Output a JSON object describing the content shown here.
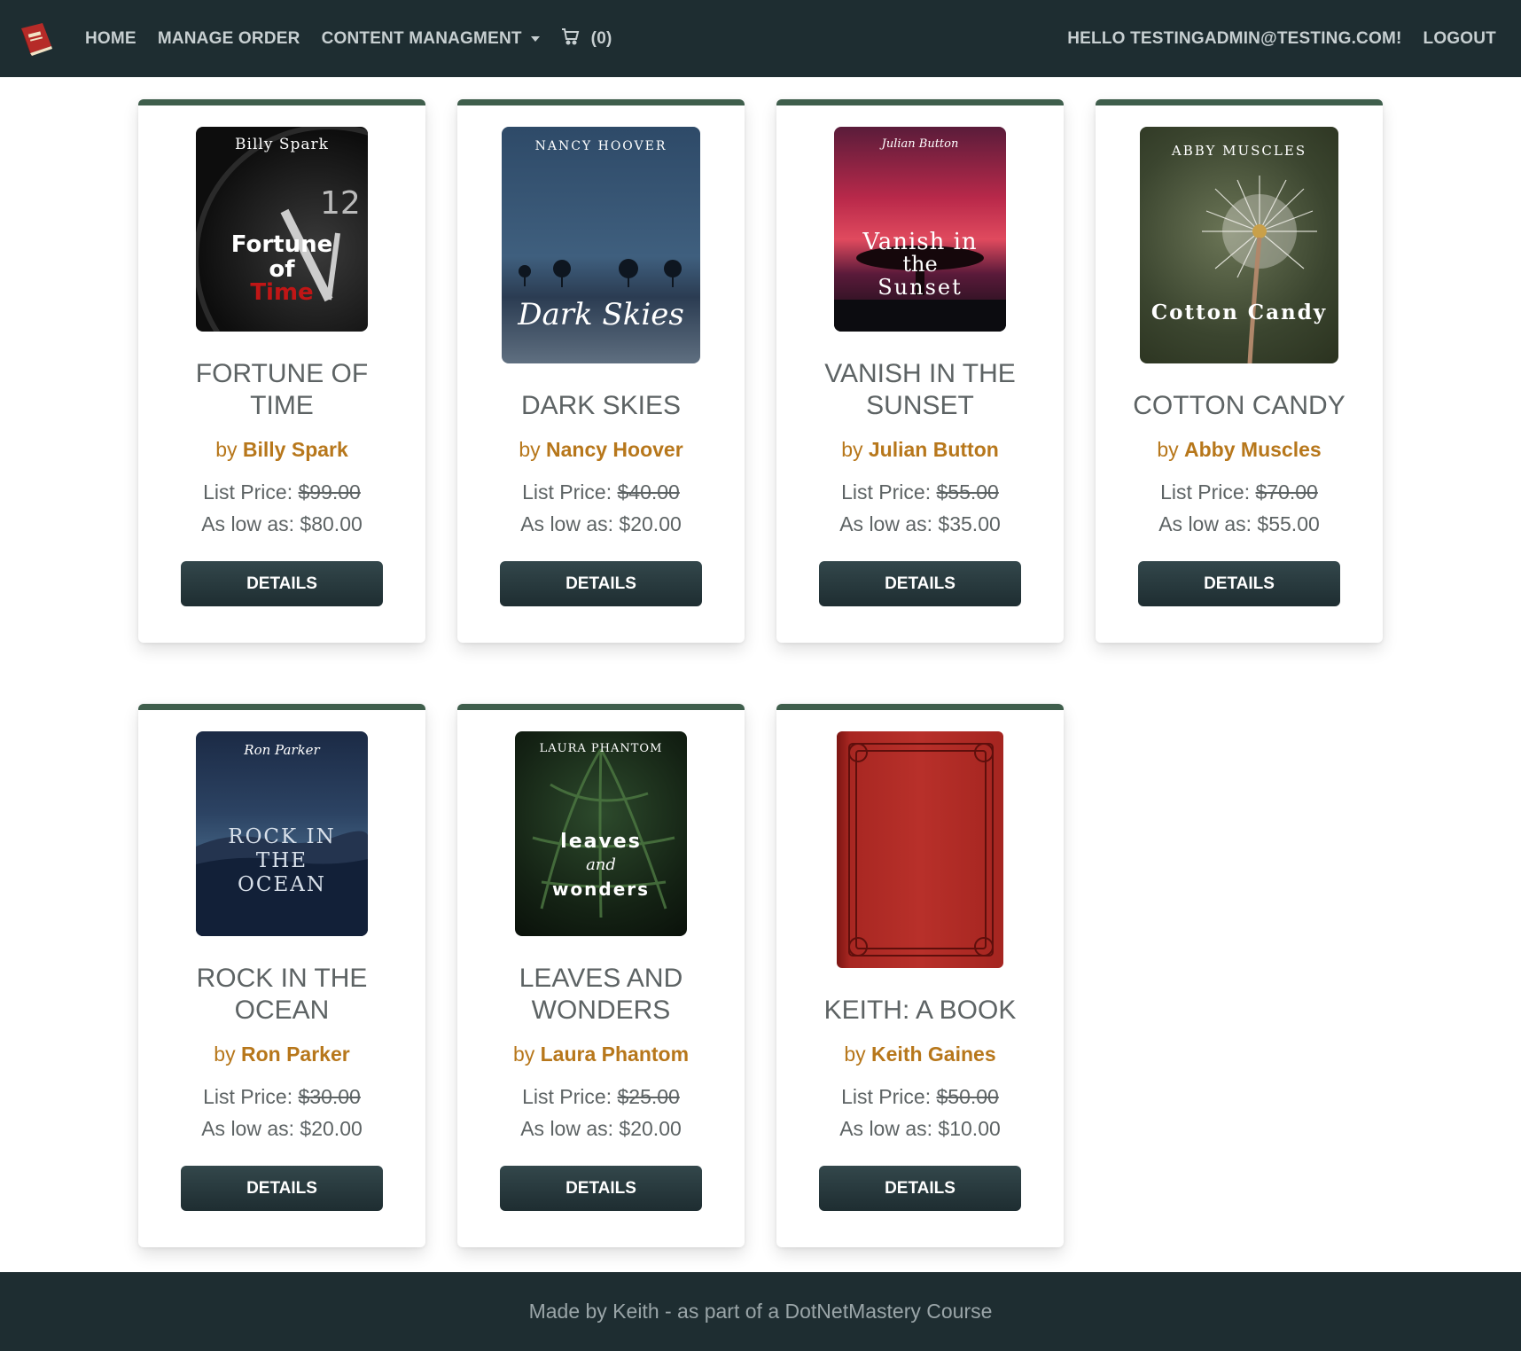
{
  "nav": {
    "home": "HOME",
    "manage_order": "MANAGE ORDER",
    "content": "CONTENT MANAGMENT",
    "cart_count": "(0)",
    "greeting": "HELLO TESTINGADMIN@TESTING.COM!",
    "logout": "LOGOUT"
  },
  "icons": {
    "brand": "book-logo-icon",
    "cart": "cart-icon",
    "dropdown": "chevron-down-icon"
  },
  "colors": {
    "nav_bg": "#1e2d31",
    "accent_border": "#3f5e4c",
    "author": "#b7771b",
    "button": "#1e2d31"
  },
  "products": [
    {
      "cover_author": "Billy Spark",
      "cover_title_1": "Fortune",
      "cover_title_2": "of",
      "cover_title_3": "Time",
      "title": "FORTUNE OF TIME",
      "title_l1": "FORTUNE OF",
      "title_l2": "TIME",
      "by": "by",
      "author": "Billy Spark",
      "list_label": "List Price: ",
      "list_price": "$99.00",
      "low_label": "As low as: $80.00",
      "button": "DETAILS"
    },
    {
      "cover_author": "NANCY HOOVER",
      "cover_title_1": "Dark Skies",
      "title_l1": "DARK SKIES",
      "by": "by",
      "author": "Nancy Hoover",
      "list_label": "List Price: ",
      "list_price": "$40.00",
      "low_label": "As low as: $20.00",
      "button": "DETAILS"
    },
    {
      "cover_author": "Julian Button",
      "cover_title_1": "Vanish in",
      "cover_title_2": "the",
      "cover_title_3": "Sunset",
      "title_l1": "VANISH IN THE",
      "title_l2": "SUNSET",
      "by": "by",
      "author": "Julian Button",
      "list_label": "List Price: ",
      "list_price": "$55.00",
      "low_label": "As low as: $35.00",
      "button": "DETAILS"
    },
    {
      "cover_author": "ABBY MUSCLES",
      "cover_title_1": "Cotton Candy",
      "title_l1": "COTTON CANDY",
      "by": "by",
      "author": "Abby Muscles",
      "list_label": "List Price: ",
      "list_price": "$70.00",
      "low_label": "As low as: $55.00",
      "button": "DETAILS"
    },
    {
      "cover_author": "Ron Parker",
      "cover_title_1": "ROCK IN",
      "cover_title_2": "THE",
      "cover_title_3": "OCEAN",
      "title_l1": "ROCK IN THE",
      "title_l2": "OCEAN",
      "by": "by",
      "author": "Ron Parker",
      "list_label": "List Price: ",
      "list_price": "$30.00",
      "low_label": "As low as: $20.00",
      "button": "DETAILS"
    },
    {
      "cover_author": "LAURA PHANTOM",
      "cover_title_1": "leaves",
      "cover_title_2": "and",
      "cover_title_3": "wonders",
      "title_l1": "LEAVES AND",
      "title_l2": "WONDERS",
      "by": "by",
      "author": "Laura Phantom",
      "list_label": "List Price: ",
      "list_price": "$25.00",
      "low_label": "As low as: $20.00",
      "button": "DETAILS"
    },
    {
      "title_l1": "KEITH: A BOOK",
      "by": "by",
      "author": "Keith Gaines",
      "list_label": "List Price: ",
      "list_price": "$50.00",
      "low_label": "As low as: $10.00",
      "button": "DETAILS"
    }
  ],
  "footer": {
    "text": "Made by Keith - as part of a DotNetMastery Course"
  }
}
